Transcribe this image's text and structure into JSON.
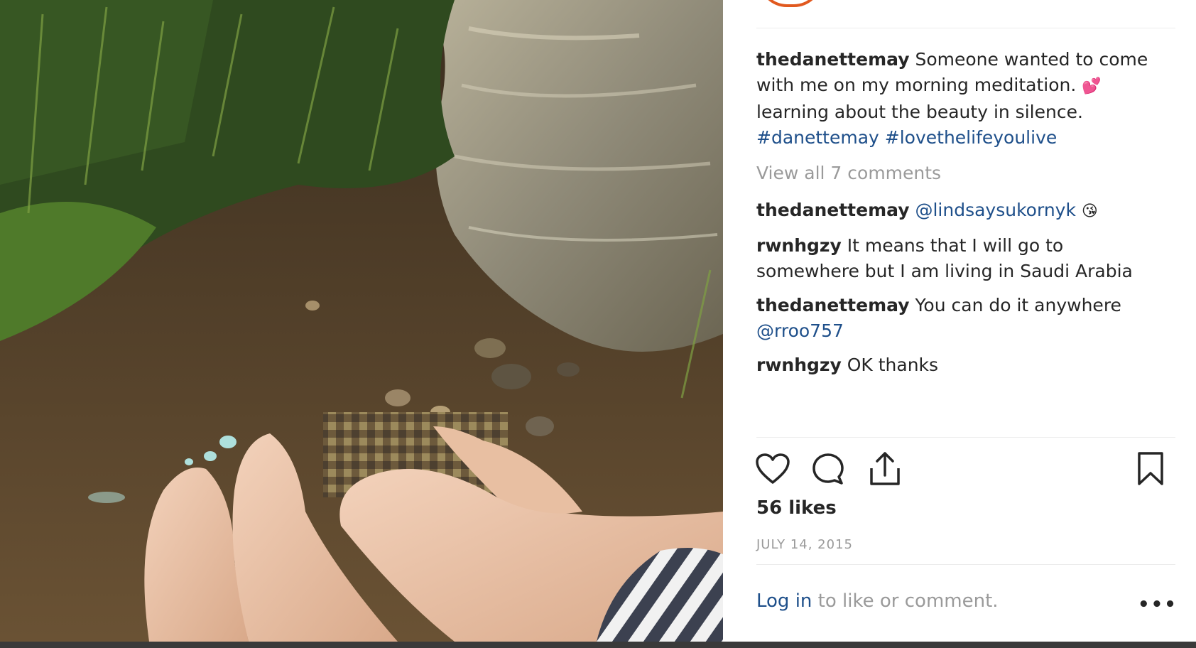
{
  "post": {
    "caption": {
      "username": "thedanettemay",
      "line1": "Someone wanted to come",
      "line2": "with me on my morning meditation.",
      "line2_emoji": "💕",
      "line3": "learning about the beauty in silence.",
      "hashtag1": "#danettemay",
      "hashtag2": "#lovethelifeyoulive"
    },
    "view_comments": "View all 7 comments",
    "comments": [
      {
        "username": "thedanettemay",
        "mention": "@lindsaysukornyk",
        "emoji": "😘"
      },
      {
        "username": "rwnhgzy",
        "text_line1": "It means that I will go to",
        "text_line2": "somewhere but I am living in Saudi Arabia"
      },
      {
        "username": "thedanettemay",
        "text_line1": "You can do it anywhere",
        "mention": "@rroo757"
      },
      {
        "username": "rwnhgzy",
        "text_line1": "OK thanks"
      }
    ],
    "likes": "56 likes",
    "date": "JULY 14, 2015",
    "login_link": "Log in",
    "login_rest": " to like or comment.",
    "more_label": "•••"
  },
  "icons": {
    "like": "heart-icon",
    "comment": "comment-bubble-icon",
    "share": "share-upload-icon",
    "save": "bookmark-icon",
    "more": "more-options-icon"
  },
  "colors": {
    "link": "#1e4f8a",
    "muted": "#9a9a9a",
    "text": "#262626",
    "story_ring": "#e1591f"
  }
}
